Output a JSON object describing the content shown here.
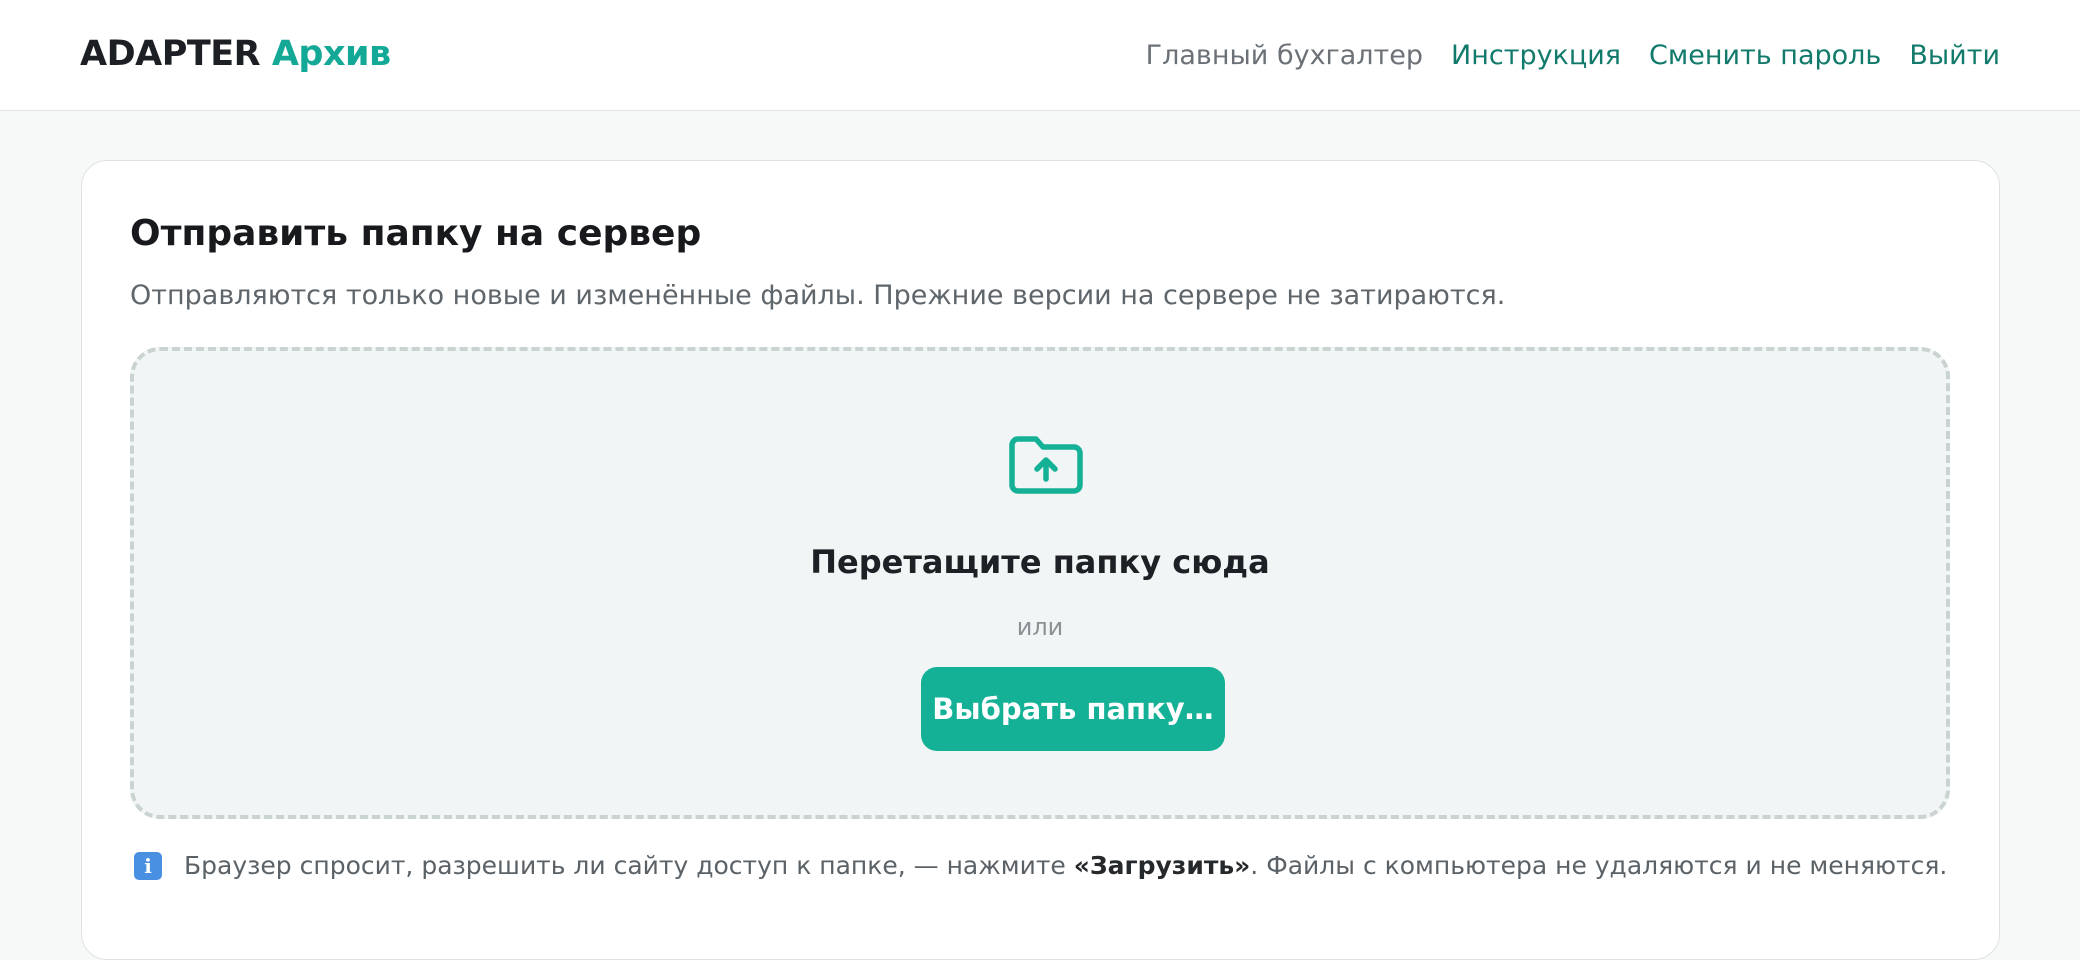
{
  "header": {
    "brand_primary": "ADAPTER",
    "brand_secondary": "Архив",
    "user_role": "Главный бухгалтер",
    "links": {
      "instructions": "Инструкция",
      "change_password": "Сменить пароль",
      "logout": "Выйти"
    }
  },
  "upload": {
    "title": "Отправить папку на сервер",
    "subtitle": "Отправляются только новые и изменённые файлы. Прежние версии на сервере не затираются.",
    "dropzone": {
      "icon": "folder-upload-icon",
      "title": "Перетащите папку сюда",
      "or": "или",
      "button": "Выбрать папку…"
    },
    "note": {
      "icon": "info-icon",
      "before": "Браузер спросит, разрешить ли сайту доступ к папке, — нажмите ",
      "emphasis": "«Загрузить»",
      "after": ". Файлы с компьютера не удаляются и не меняются."
    }
  },
  "colors": {
    "accent": "#14b197",
    "brand_accent": "#14a896",
    "link": "#117a6b",
    "info": "#4a90e2"
  }
}
